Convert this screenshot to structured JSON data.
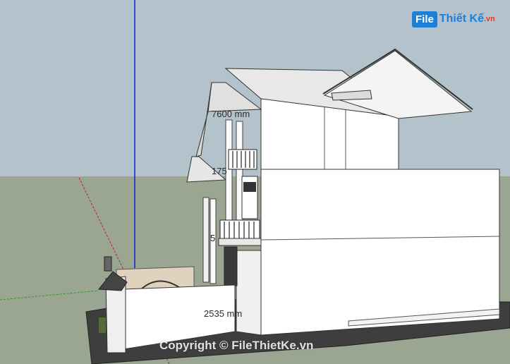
{
  "watermark": {
    "logo_file": "File",
    "logo_name": "Thiết Kế",
    "logo_domain": ".vn",
    "copyright": "Copyright © FileThietKe.vn"
  },
  "dimensions": {
    "dim_top": "7600 mm",
    "dim_mid": "175",
    "dim_small": "5",
    "dim_bottom": "2535 mm"
  },
  "colors": {
    "sky": "#b4c3cb",
    "ground": "#9aa592",
    "blue_axis": "#1020d0",
    "red_axis": "#c02020",
    "green_axis": "#20a020"
  }
}
